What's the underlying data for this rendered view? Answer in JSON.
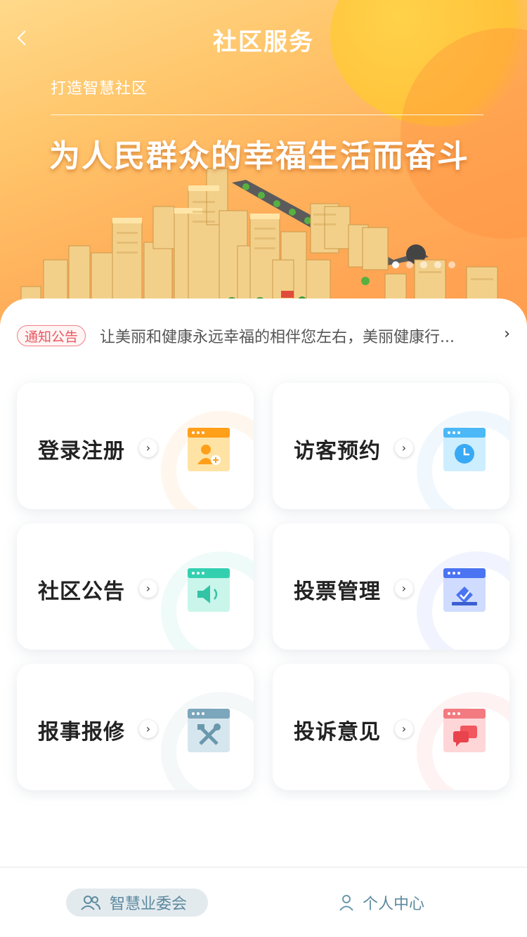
{
  "header": {
    "back_icon": "chevron-left-icon",
    "title": "社区服务",
    "subtitle": "打造智慧社区",
    "slogan": "为人民群众的幸福生活而奋斗",
    "carousel": {
      "count": 5,
      "active_index": 0
    }
  },
  "notice": {
    "badge": "通知公告",
    "text": "让美丽和健康永远幸福的相伴您左右，美丽健康行...",
    "arrow": "›"
  },
  "services": [
    {
      "label": "登录注册",
      "icon": "user-add-icon",
      "accent": "#ff9f1a"
    },
    {
      "label": "访客预约",
      "icon": "clock-icon",
      "accent": "#3aa9f5"
    },
    {
      "label": "社区公告",
      "icon": "speaker-icon",
      "accent": "#33d0b0"
    },
    {
      "label": "投票管理",
      "icon": "vote-icon",
      "accent": "#4a74f2"
    },
    {
      "label": "报事报修",
      "icon": "tools-icon",
      "accent": "#6fa0b8"
    },
    {
      "label": "投诉意见",
      "icon": "chat-icon",
      "accent": "#f2565e"
    }
  ],
  "tabbar": {
    "tab1": "智慧业委会",
    "tab2": "个人中心",
    "active_color": "#5d8a9f",
    "active_bg": "#e3eaee"
  }
}
